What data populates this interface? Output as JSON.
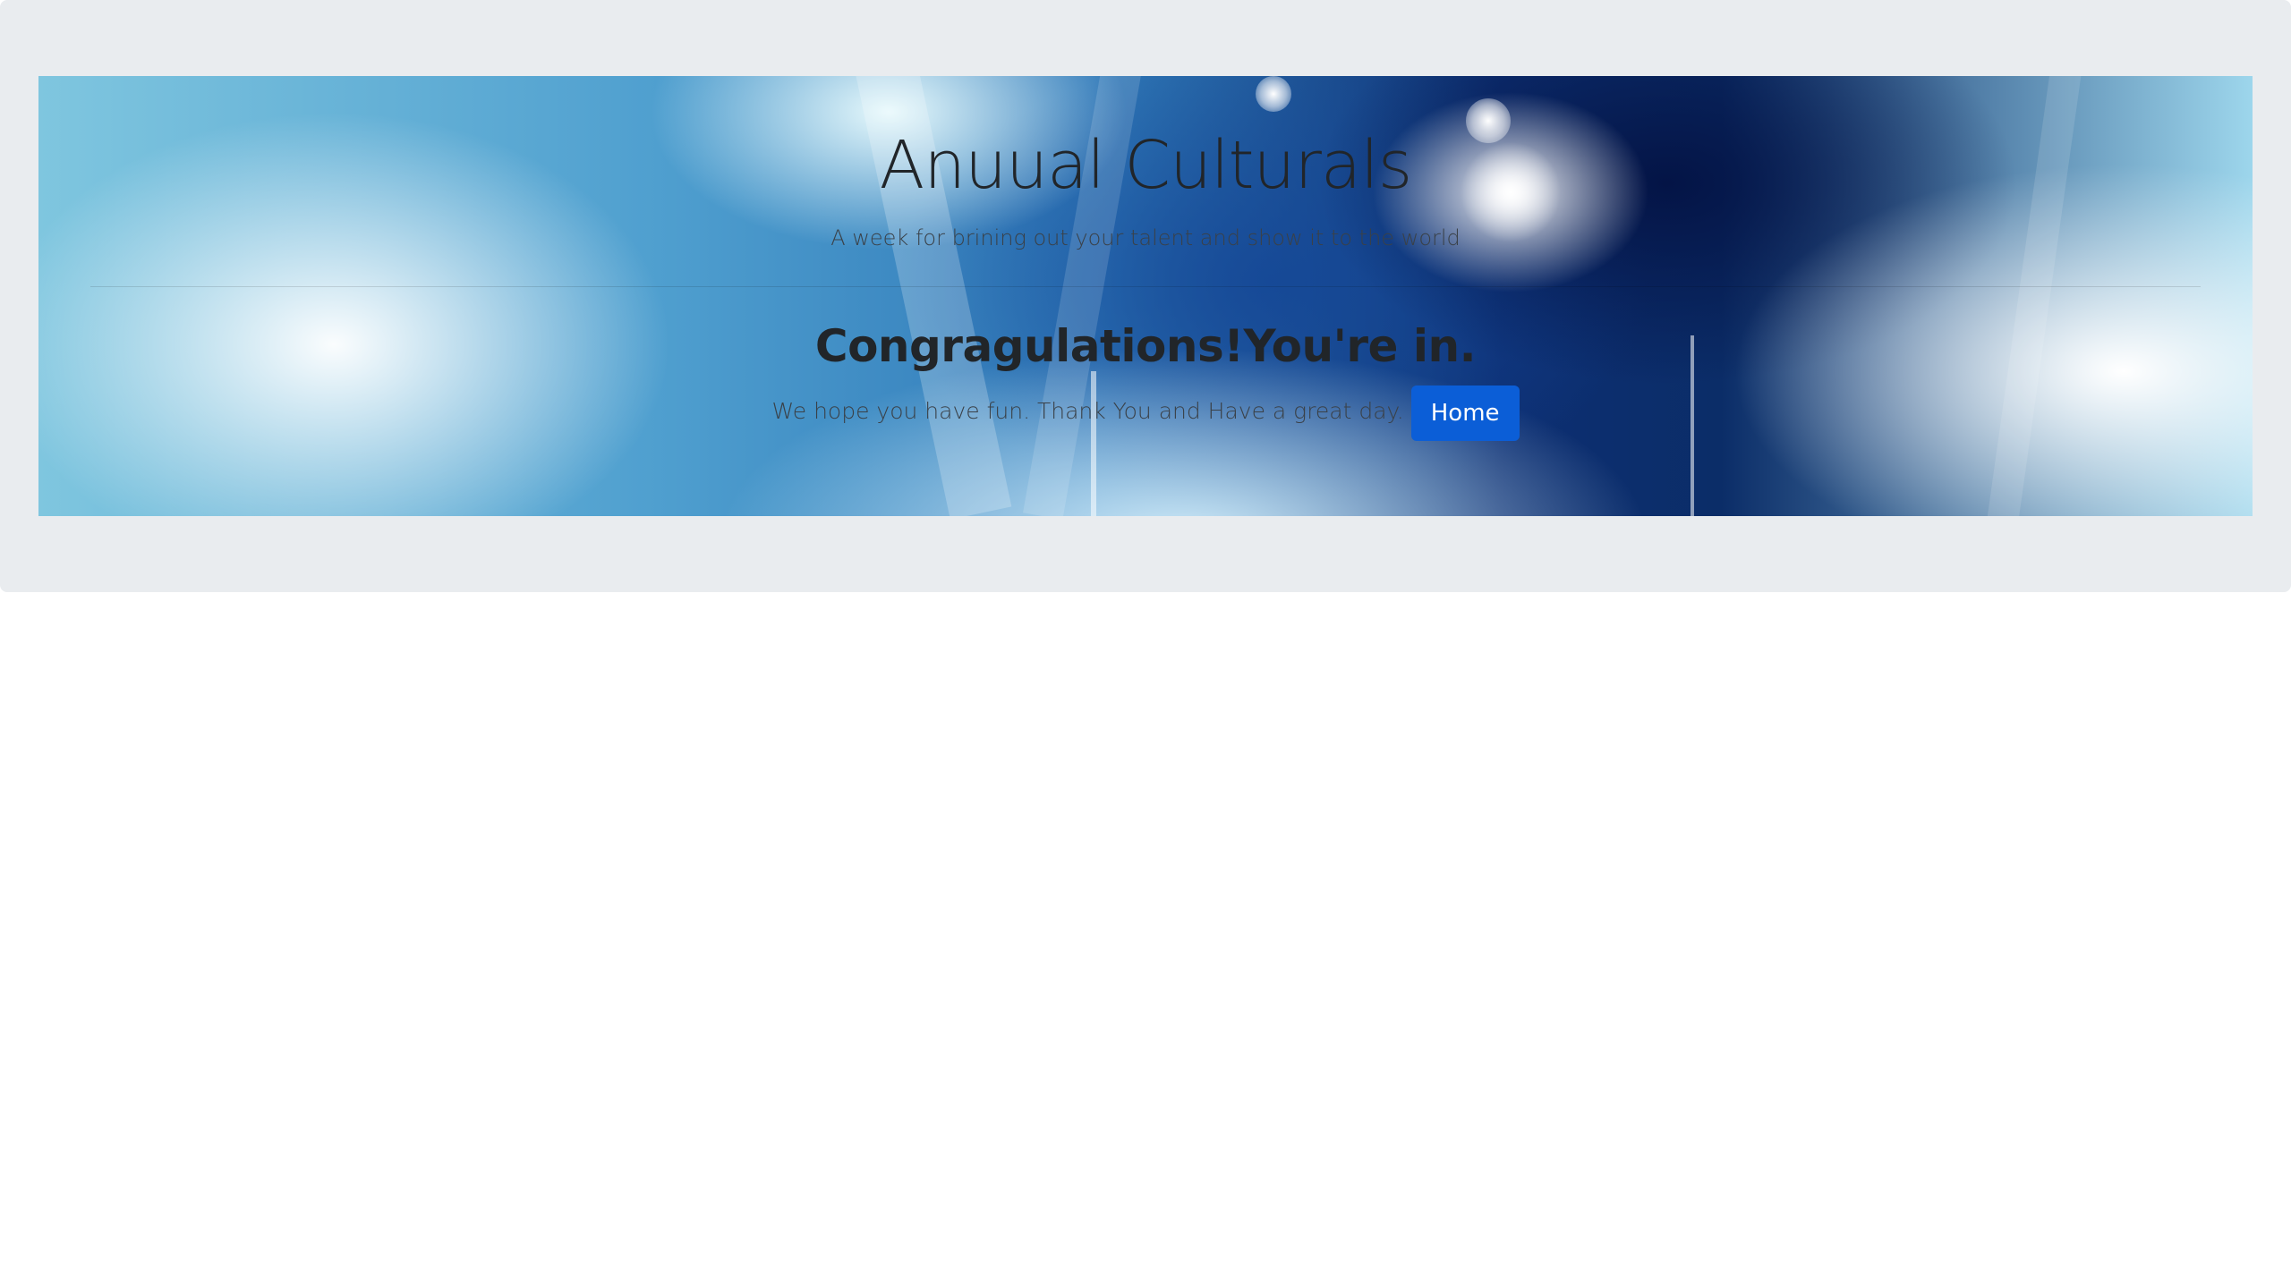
{
  "hero": {
    "title": "Anuual Culturals",
    "subtitle": "A week for brining out your talent and show it to the world",
    "heading": "Congragulations!You're in.",
    "message": "We hope you have fun. Thank You and Have a great day.",
    "home_button_label": "Home"
  },
  "colors": {
    "page_background": "#ffffff",
    "jumbotron_background": "#e9ecef",
    "primary_button": "#0b5ed7",
    "text": "#212529"
  },
  "icons": {
    "background": "concert-stage-lights-image"
  }
}
